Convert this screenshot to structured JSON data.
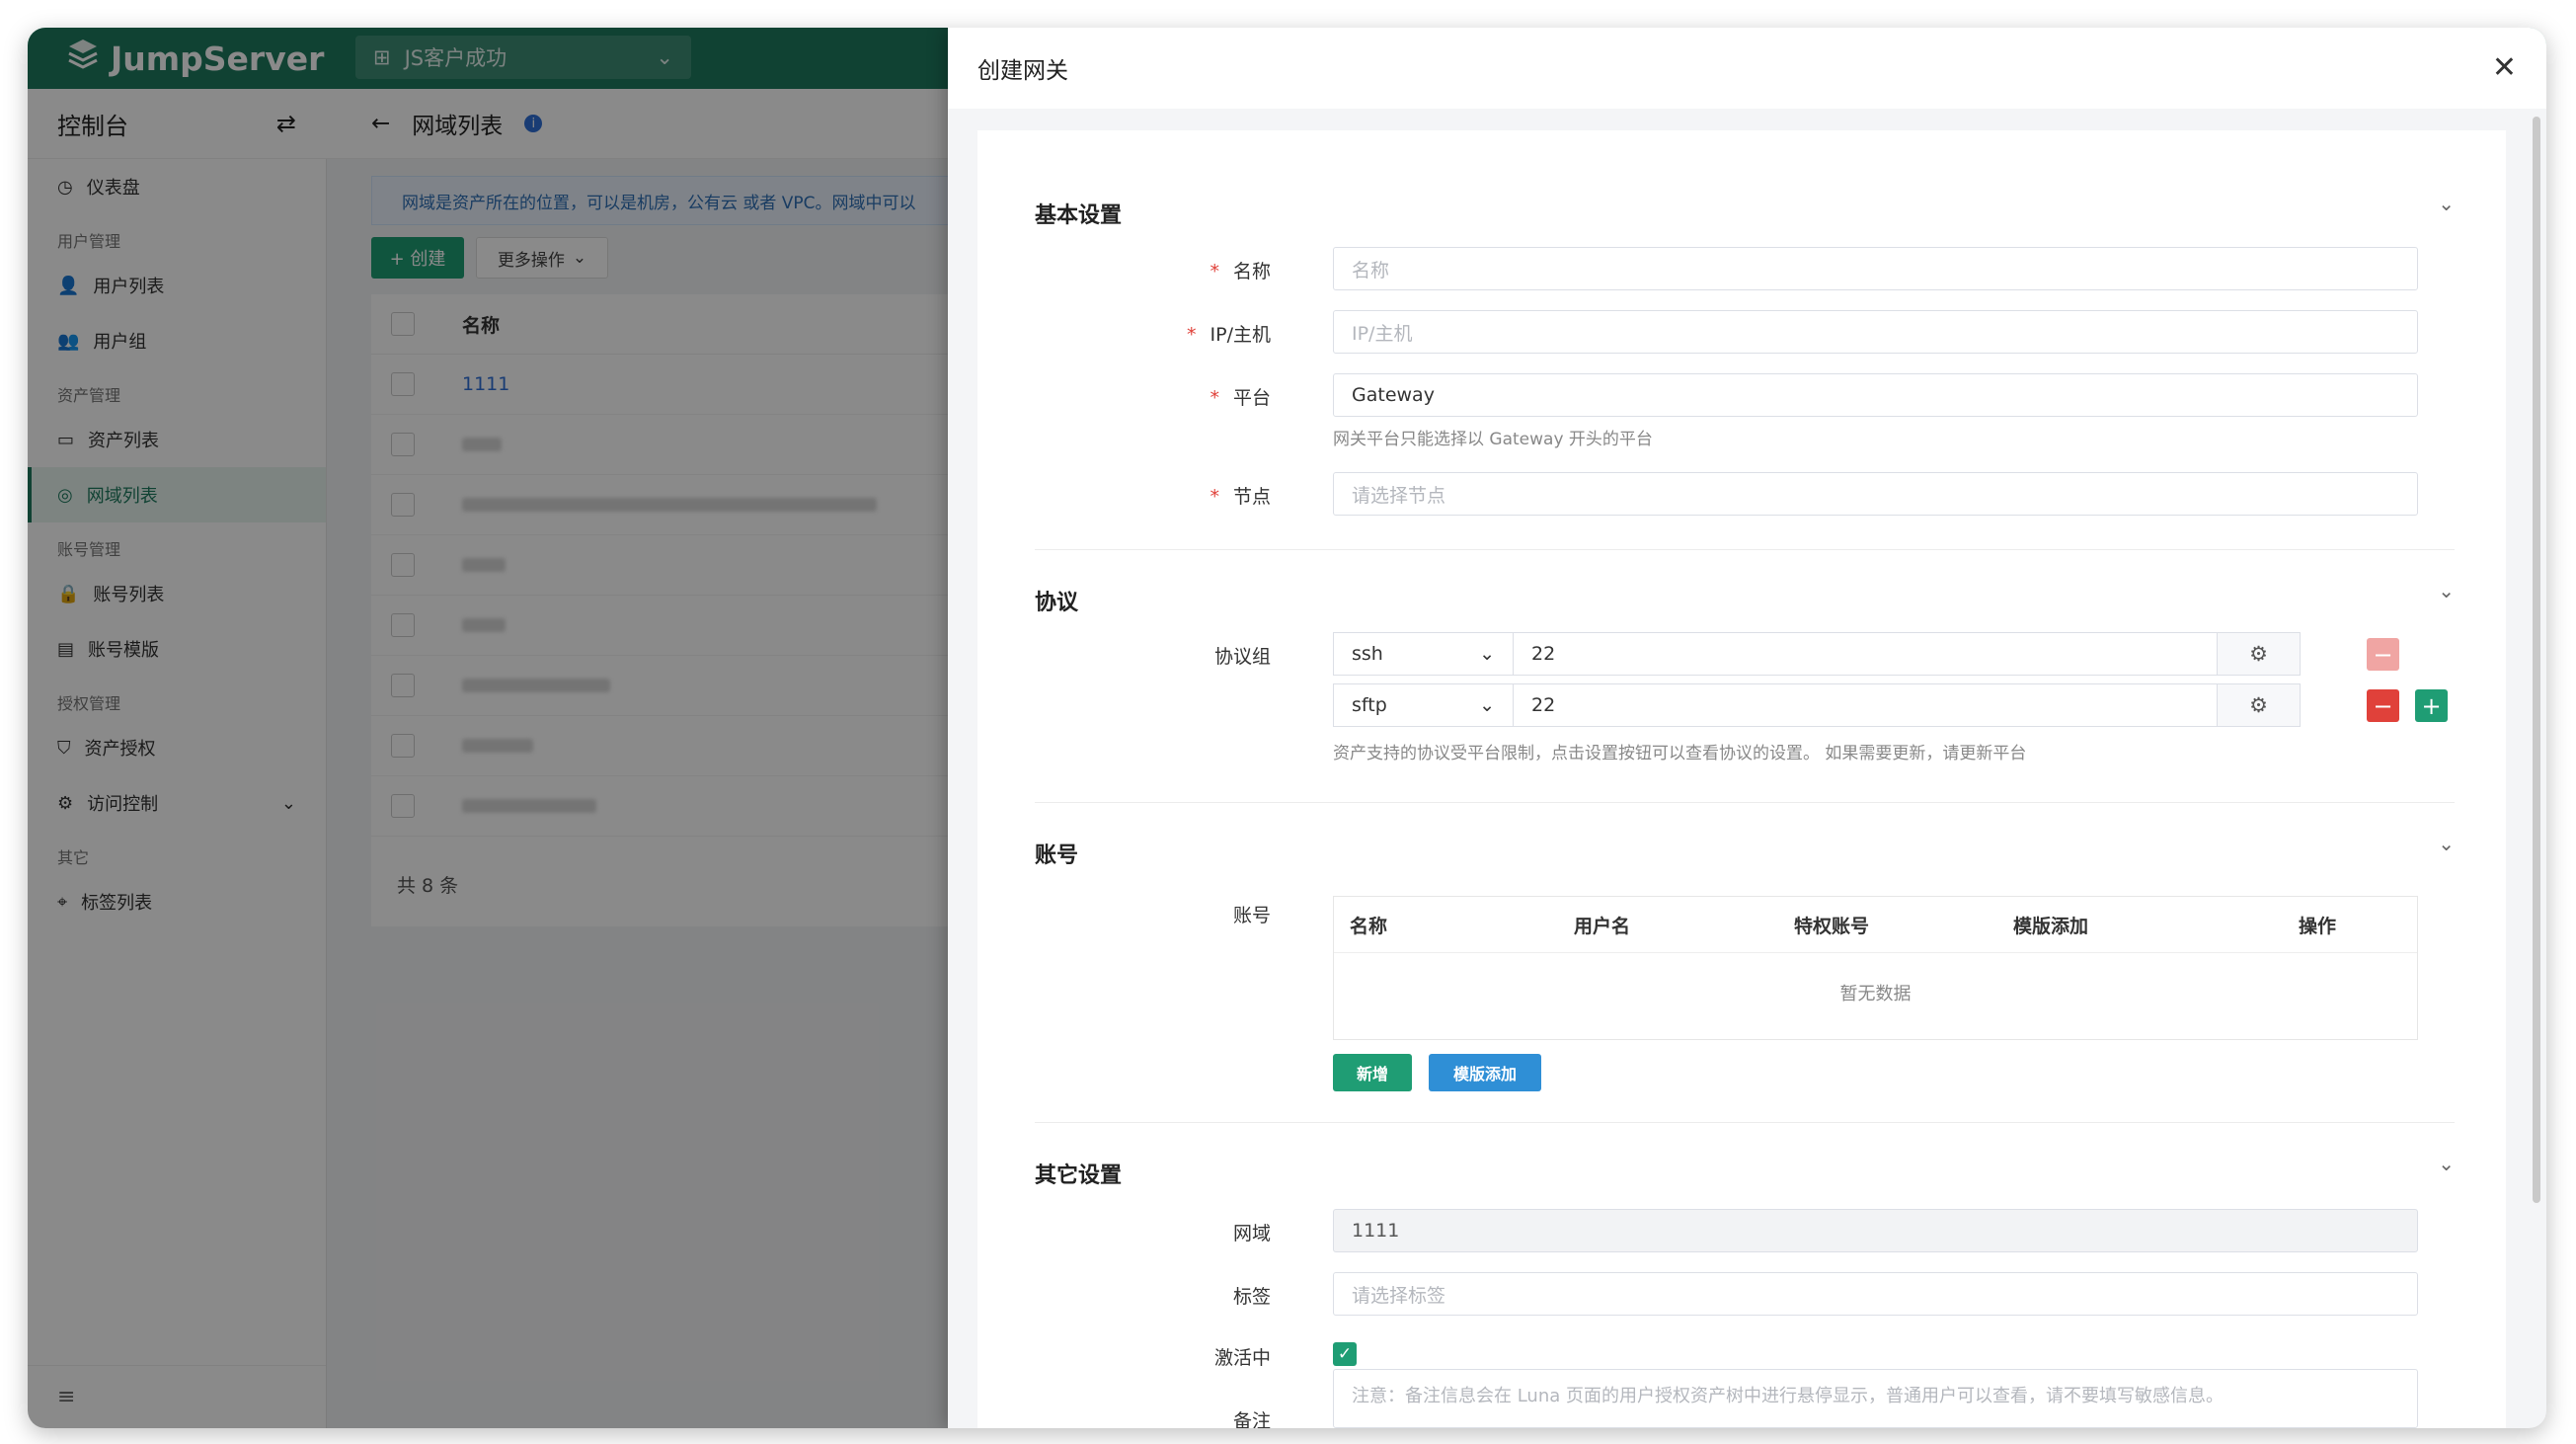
{
  "app": {
    "logo_text": "JumpServer",
    "org": "JS客户成功"
  },
  "sidebar": {
    "title": "控制台",
    "dashboard": "仪表盘",
    "groups": [
      {
        "label": "用户管理",
        "items": [
          "用户列表",
          "用户组"
        ]
      },
      {
        "label": "资产管理",
        "items": [
          "资产列表",
          "网域列表"
        ]
      },
      {
        "label": "账号管理",
        "items": [
          "账号列表",
          "账号模版"
        ]
      },
      {
        "label": "授权管理",
        "items": [
          "资产授权",
          "访问控制"
        ]
      },
      {
        "label": "其它",
        "items": [
          "标签列表"
        ]
      }
    ]
  },
  "page": {
    "title": "网域列表",
    "notice": "网域是资产所在的位置，可以是机房，公有云 或者 VPC。网域中可以",
    "create_label": "+ 创建",
    "more_label": "更多操作",
    "column_name": "名称",
    "first_row": "1111",
    "total": "共 8 条"
  },
  "drawer": {
    "title": "创建网关",
    "basic": {
      "section": "基本设置",
      "name_label": "名称",
      "name_placeholder": "名称",
      "ip_label": "IP/主机",
      "ip_placeholder": "IP/主机",
      "platform_label": "平台",
      "platform_value": "Gateway",
      "platform_hint": "网关平台只能选择以 Gateway 开头的平台",
      "node_label": "节点",
      "node_placeholder": "请选择节点"
    },
    "protocol": {
      "section": "协议",
      "group_label": "协议组",
      "rows": [
        {
          "name": "ssh",
          "port": "22"
        },
        {
          "name": "sftp",
          "port": "22"
        }
      ],
      "hint": "资产支持的协议受平台限制，点击设置按钮可以查看协议的设置。 如果需要更新，请更新平台"
    },
    "account": {
      "section": "账号",
      "label": "账号",
      "columns": [
        "名称",
        "用户名",
        "特权账号",
        "模版添加",
        "操作"
      ],
      "empty": "暂无数据",
      "add_label": "新增",
      "template_label": "模版添加"
    },
    "other": {
      "section": "其它设置",
      "domain_label": "网域",
      "domain_value": "1111",
      "tag_label": "标签",
      "tag_placeholder": "请选择标签",
      "active_label": "激活中",
      "comment_label": "备注",
      "comment_placeholder": "注意：备注信息会在 Luna 页面的用户授权资产树中进行悬停显示，普通用户可以查看，请不要填写敏感信息。"
    }
  },
  "colors": {
    "brand": "#1f7a5f",
    "primary": "#1f9d74",
    "danger": "#e0413a",
    "info": "#2f8fd6"
  }
}
